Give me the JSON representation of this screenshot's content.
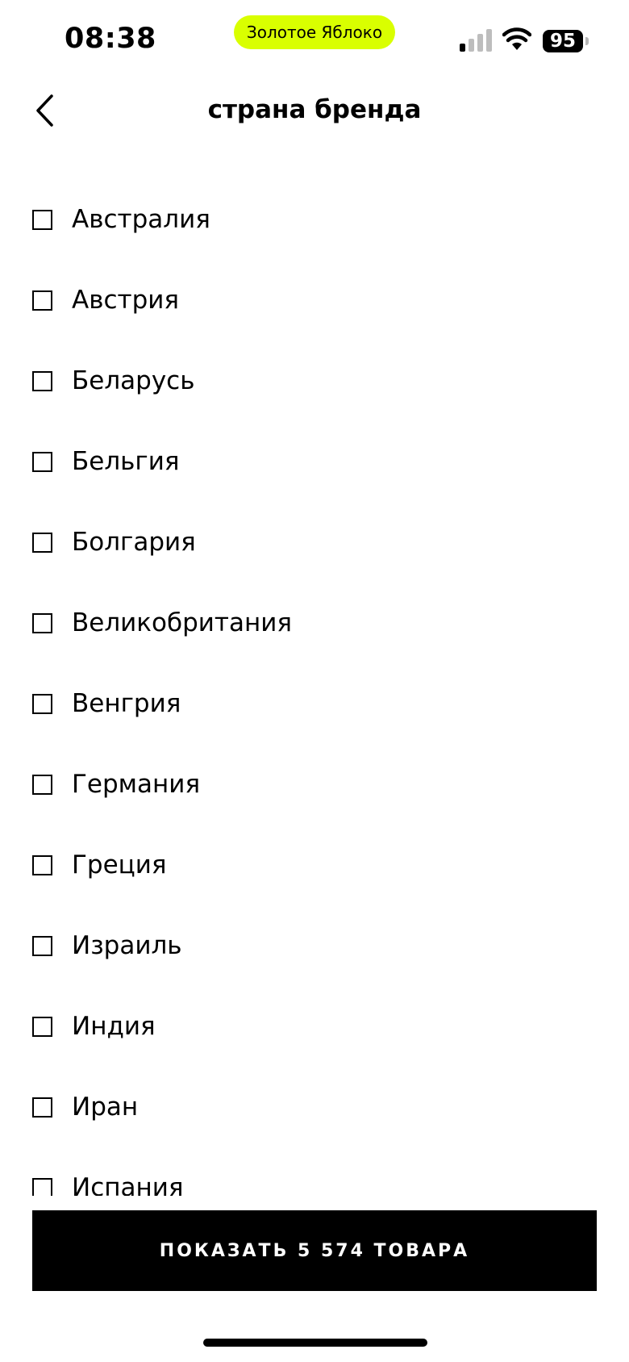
{
  "status_bar": {
    "time": "08:38",
    "app_name": "Золотое Яблоко",
    "battery": "95",
    "icons": [
      "signal-icon",
      "wifi-icon",
      "battery-icon"
    ],
    "accent_color": "#d9ff00"
  },
  "header": {
    "title": "страна бренда",
    "back_icon": "chevron-left-icon"
  },
  "filter": {
    "items": [
      {
        "label": "Австралия",
        "checked": false
      },
      {
        "label": "Австрия",
        "checked": false
      },
      {
        "label": "Беларусь",
        "checked": false
      },
      {
        "label": "Бельгия",
        "checked": false
      },
      {
        "label": "Болгария",
        "checked": false
      },
      {
        "label": "Великобритания",
        "checked": false
      },
      {
        "label": "Венгрия",
        "checked": false
      },
      {
        "label": "Германия",
        "checked": false
      },
      {
        "label": "Греция",
        "checked": false
      },
      {
        "label": "Израиль",
        "checked": false
      },
      {
        "label": "Индия",
        "checked": false
      },
      {
        "label": "Иран",
        "checked": false
      },
      {
        "label": "Испания",
        "checked": false
      }
    ]
  },
  "footer": {
    "show_button_label": "ПОКАЗАТЬ 5 574 ТОВАРА"
  }
}
